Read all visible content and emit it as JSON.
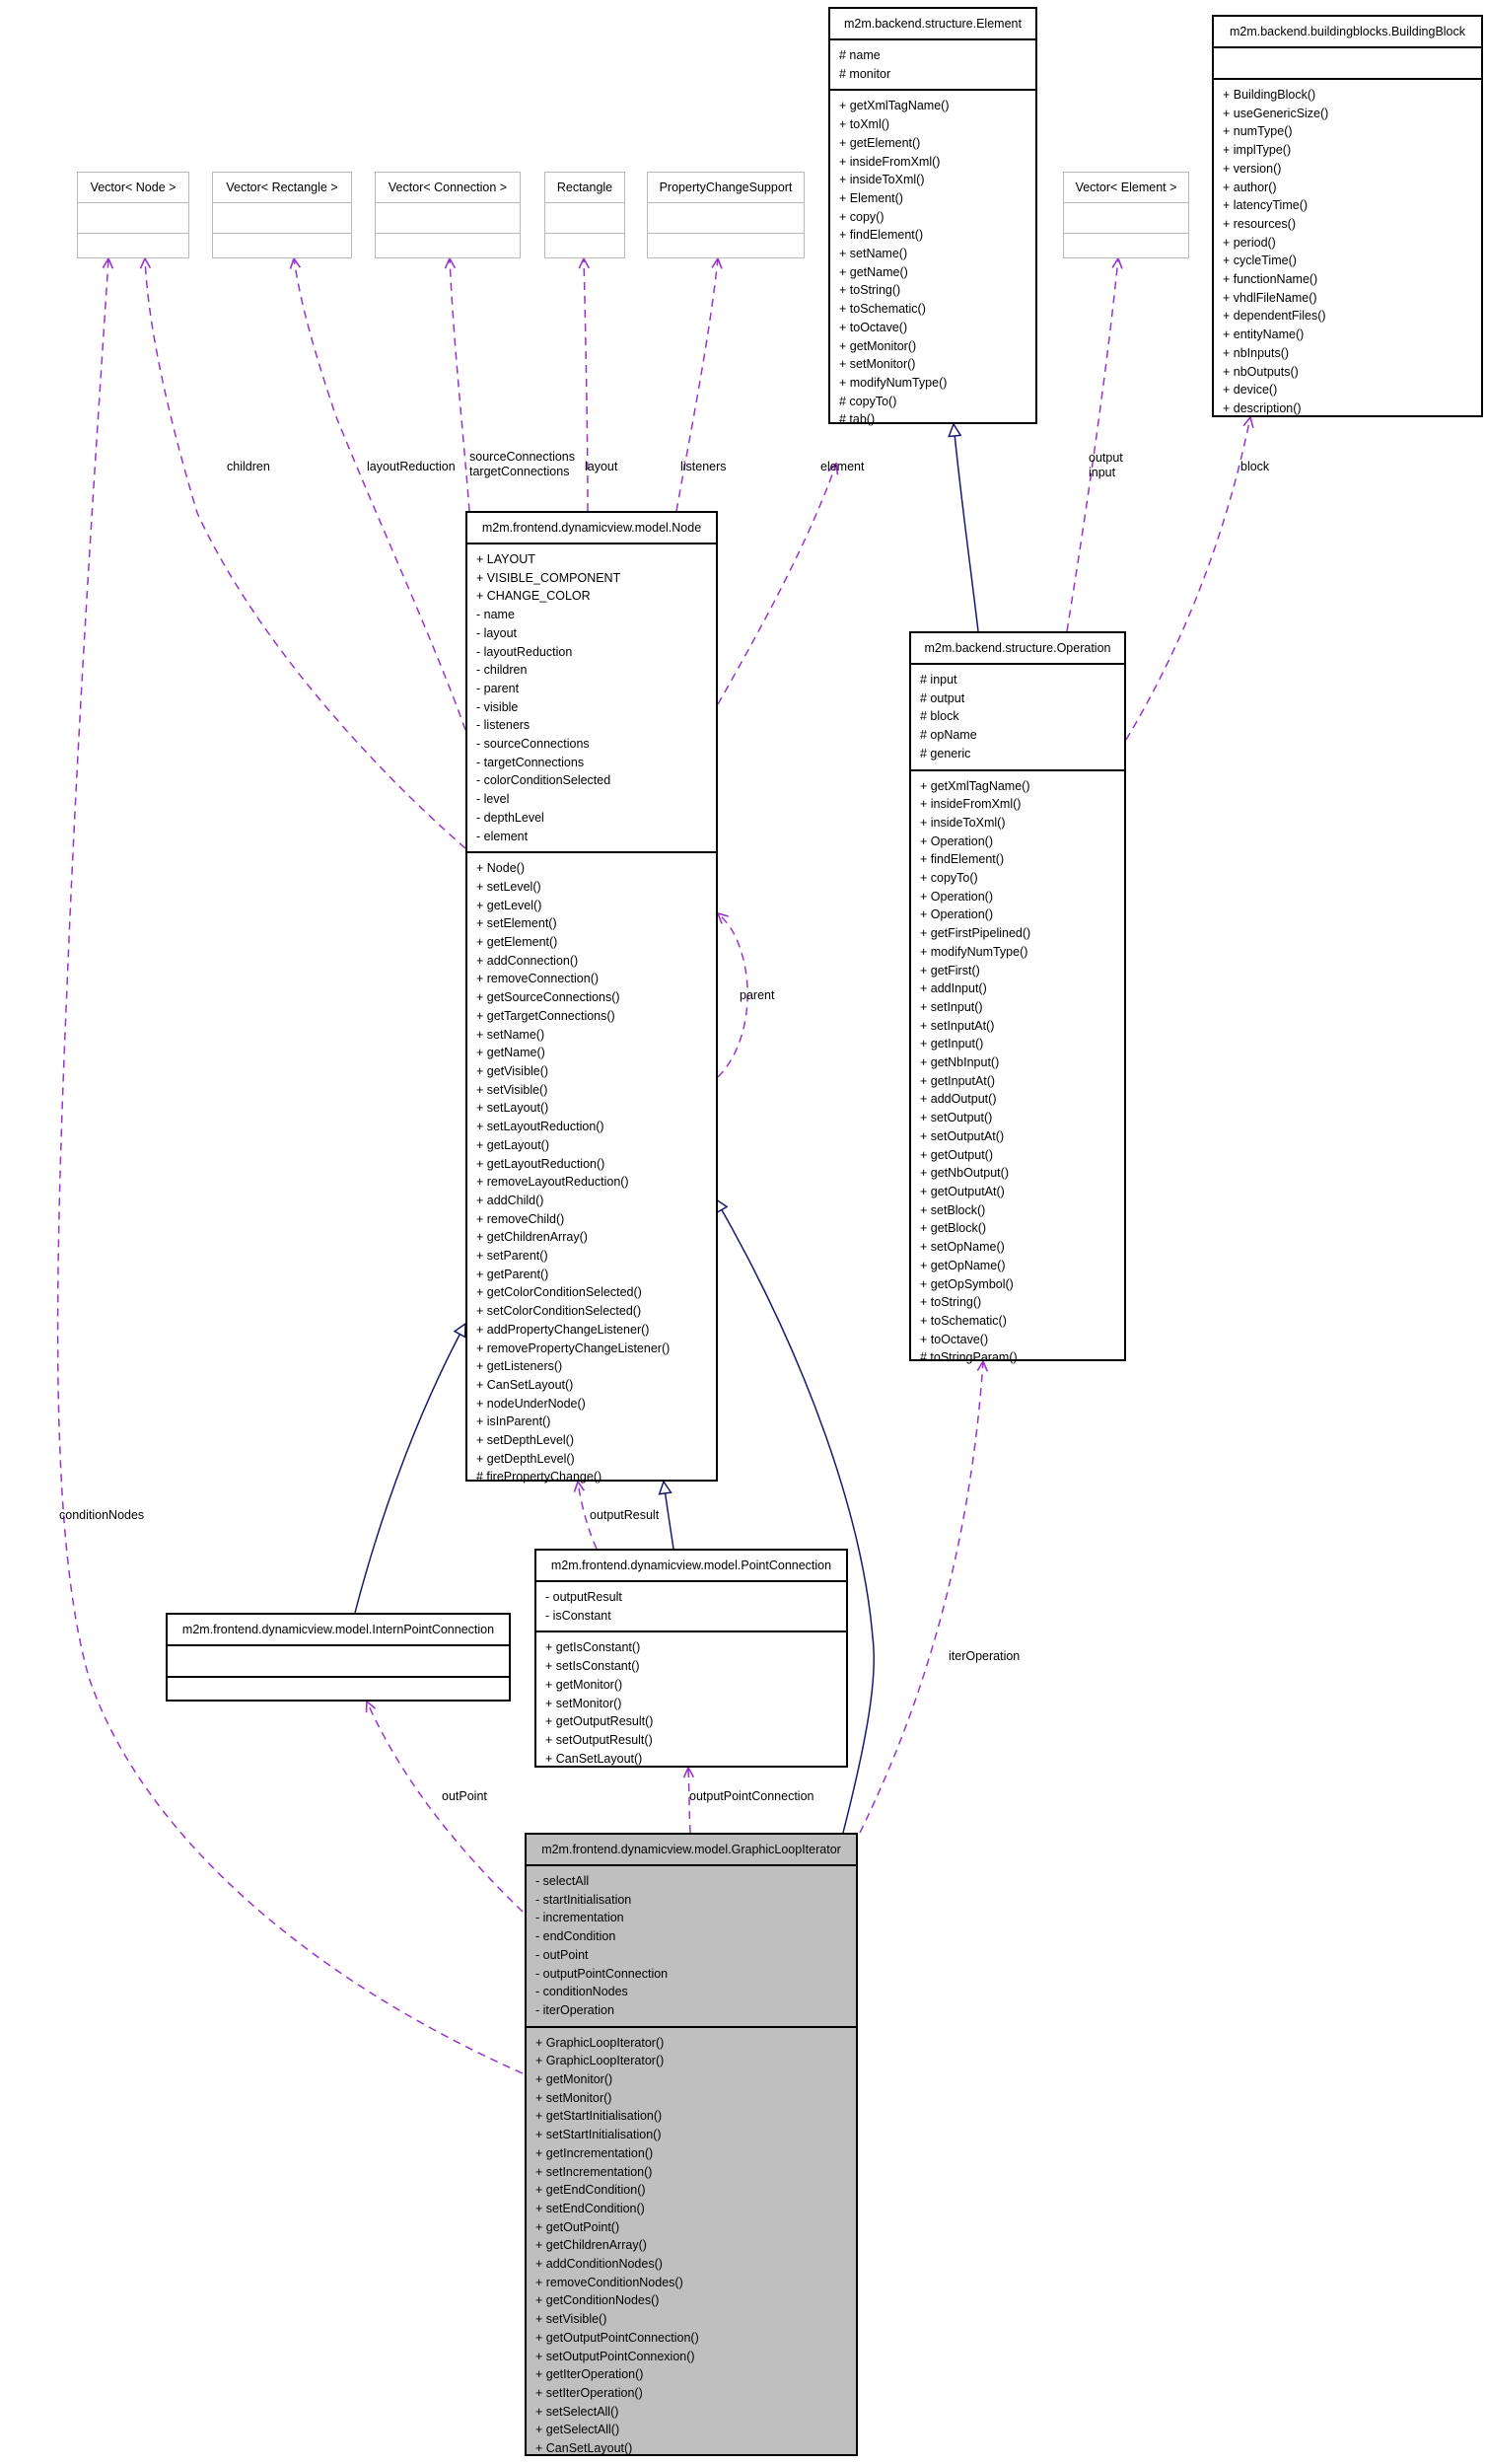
{
  "colors": {
    "dependency": "#9a32cd",
    "inheritance": "#191970",
    "focus_fill": "#bfbfbf",
    "stub_border": "#b8b8b8"
  },
  "classes": {
    "element": {
      "name": "m2m.backend.structure.Element",
      "attributes": [
        "# name",
        "# monitor"
      ],
      "methods": [
        "+ getXmlTagName()",
        "+ toXml()",
        "+ getElement()",
        "+ insideFromXml()",
        "+ insideToXml()",
        "+ Element()",
        "+ copy()",
        "+ findElement()",
        "+ setName()",
        "+ getName()",
        "+ toString()",
        "+ toSchematic()",
        "+ toOctave()",
        "+ getMonitor()",
        "+ setMonitor()",
        "+ modifyNumType()",
        "# copyTo()",
        "# tab()"
      ]
    },
    "building_block": {
      "name": "m2m.backend.buildingblocks.BuildingBlock",
      "attributes": [],
      "methods": [
        "+ BuildingBlock()",
        "+ useGenericSize()",
        "+ numType()",
        "+ implType()",
        "+ version()",
        "+ author()",
        "+ latencyTime()",
        "+ resources()",
        "+ period()",
        "+ cycleTime()",
        "+ functionName()",
        "+ vhdlFileName()",
        "+ dependentFiles()",
        "+ entityName()",
        "+ nbInputs()",
        "+ nbOutputs()",
        "+ device()",
        "+ description()"
      ]
    },
    "vector_node": {
      "name": "Vector< Node >"
    },
    "vector_rectangle": {
      "name": "Vector< Rectangle >"
    },
    "vector_connection": {
      "name": "Vector< Connection >"
    },
    "rectangle": {
      "name": "Rectangle"
    },
    "property_change_support": {
      "name": "PropertyChangeSupport"
    },
    "vector_element": {
      "name": "Vector< Element >"
    },
    "node": {
      "name": "m2m.frontend.dynamicview.model.Node",
      "attributes": [
        "+ LAYOUT",
        "+ VISIBLE_COMPONENT",
        "+ CHANGE_COLOR",
        "- name",
        "- layout",
        "- layoutReduction",
        "- children",
        "- parent",
        "- visible",
        "- listeners",
        "- sourceConnections",
        "- targetConnections",
        "- colorConditionSelected",
        "- level",
        "- depthLevel",
        "- element"
      ],
      "methods": [
        "+ Node()",
        "+ setLevel()",
        "+ getLevel()",
        "+ setElement()",
        "+ getElement()",
        "+ addConnection()",
        "+ removeConnection()",
        "+ getSourceConnections()",
        "+ getTargetConnections()",
        "+ setName()",
        "+ getName()",
        "+ getVisible()",
        "+ setVisible()",
        "+ setLayout()",
        "+ setLayoutReduction()",
        "+ getLayout()",
        "+ getLayoutReduction()",
        "+ removeLayoutReduction()",
        "+ addChild()",
        "+ removeChild()",
        "+ getChildrenArray()",
        "+ setParent()",
        "+ getParent()",
        "+ getColorConditionSelected()",
        "+ setColorConditionSelected()",
        "+ addPropertyChangeListener()",
        "+ removePropertyChangeListener()",
        "+ getListeners()",
        "+ CanSetLayout()",
        "+ nodeUnderNode()",
        "+ isInParent()",
        "+ setDepthLevel()",
        "+ getDepthLevel()",
        "# firePropertyChange()"
      ]
    },
    "operation": {
      "name": "m2m.backend.structure.Operation",
      "attributes": [
        "# input",
        "# output",
        "# block",
        "# opName",
        "# generic"
      ],
      "methods": [
        "+ getXmlTagName()",
        "+ insideFromXml()",
        "+ insideToXml()",
        "+ Operation()",
        "+ findElement()",
        "+ copyTo()",
        "+ Operation()",
        "+ Operation()",
        "+ getFirstPipelined()",
        "+ modifyNumType()",
        "+ getFirst()",
        "+ addInput()",
        "+ setInput()",
        "+ setInputAt()",
        "+ getInput()",
        "+ getNbInput()",
        "+ getInputAt()",
        "+ addOutput()",
        "+ setOutput()",
        "+ setOutputAt()",
        "+ getOutput()",
        "+ getNbOutput()",
        "+ getOutputAt()",
        "+ setBlock()",
        "+ getBlock()",
        "+ setOpName()",
        "+ getOpName()",
        "+ getOpSymbol()",
        "+ toString()",
        "+ toSchematic()",
        "+ toOctave()",
        "# toStringParam()"
      ]
    },
    "intern_point_connection": {
      "name": "m2m.frontend.dynamicview.model.InternPointConnection",
      "attributes": [],
      "methods": []
    },
    "point_connection": {
      "name": "m2m.frontend.dynamicview.model.PointConnection",
      "attributes": [
        "- outputResult",
        "- isConstant"
      ],
      "methods": [
        "+ getIsConstant()",
        "+ setIsConstant()",
        "+ getMonitor()",
        "+ setMonitor()",
        "+ getOutputResult()",
        "+ setOutputResult()",
        "+ CanSetLayout()"
      ]
    },
    "graphic_loop_iterator": {
      "name": "m2m.frontend.dynamicview.model.GraphicLoopIterator",
      "attributes": [
        "- selectAll",
        "- startInitialisation",
        "- incrementation",
        "- endCondition",
        "- outPoint",
        "- outputPointConnection",
        "- conditionNodes",
        "- iterOperation"
      ],
      "methods": [
        "+ GraphicLoopIterator()",
        "+ GraphicLoopIterator()",
        "+ getMonitor()",
        "+ setMonitor()",
        "+ getStartInitialisation()",
        "+ setStartInitialisation()",
        "+ getIncrementation()",
        "+ setIncrementation()",
        "+ getEndCondition()",
        "+ setEndCondition()",
        "+ getOutPoint()",
        "+ getChildrenArray()",
        "+ addConditionNodes()",
        "+ removeConditionNodes()",
        "+ getConditionNodes()",
        "+ setVisible()",
        "+ getOutputPointConnection()",
        "+ setOutputPointConnexion()",
        "+ getIterOperation()",
        "+ setIterOperation()",
        "+ setSelectAll()",
        "+ getSelectAll()",
        "+ CanSetLayout()"
      ]
    }
  },
  "edge_labels": {
    "children": "children",
    "layout_reduction": "layoutReduction",
    "source_target_connections": "sourceConnections\ntargetConnections",
    "layout": "layout",
    "listeners": "listeners",
    "element": "element",
    "output_input": "output\ninput",
    "block": "block",
    "parent": "parent",
    "output_result": "outputResult",
    "condition_nodes": "conditionNodes",
    "iter_operation": "iterOperation",
    "out_point": "outPoint",
    "output_point_connection": "outputPointConnection"
  }
}
